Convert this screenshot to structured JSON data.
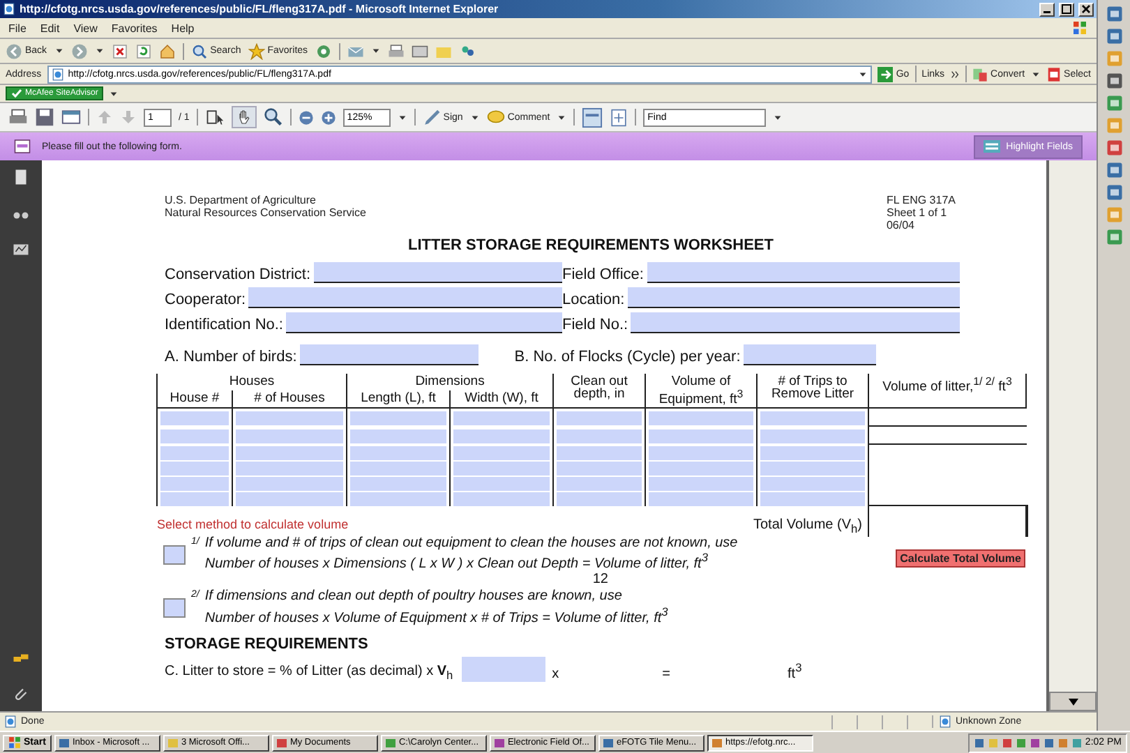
{
  "window": {
    "title": "http://cfotg.nrcs.usda.gov/references/public/FL/fleng317A.pdf - Microsoft Internet Explorer"
  },
  "menu": [
    "File",
    "Edit",
    "View",
    "Favorites",
    "Help"
  ],
  "toolbar": {
    "back": "Back",
    "search": "Search",
    "favorites": "Favorites"
  },
  "address": {
    "label": "Address",
    "url": "http://cfotg.nrcs.usda.gov/references/public/FL/fleng317A.pdf",
    "go": "Go",
    "links": "Links",
    "convert": "Convert",
    "select": "Select"
  },
  "mcafee": "McAfee SiteAdvisor",
  "pdf_toolbar": {
    "page": "1",
    "pages": "/ 1",
    "zoom": "125%",
    "sign": "Sign",
    "comment": "Comment",
    "find": "Find"
  },
  "form_bar": {
    "message": "Please fill out the following form.",
    "button": "Highlight Fields"
  },
  "document": {
    "agency": [
      "U.S. Department of Agriculture",
      "Natural Resources Conservation Service"
    ],
    "form_id": [
      "FL ENG 317A",
      "Sheet 1 of 1",
      "06/04"
    ],
    "title": "LITTER STORAGE REQUIREMENTS WORKSHEET",
    "field_rows": [
      [
        "Conservation District:",
        "Field Office:"
      ],
      [
        "Cooperator:",
        "Location:"
      ],
      [
        "Identification No.:",
        "Field No.:"
      ]
    ],
    "birds": "A.  Number of birds:",
    "flocks": "B.  No. of Flocks (Cycle) per year:",
    "table": {
      "column_groups": [
        {
          "label": "Houses",
          "columns": [
            "House #",
            "# of Houses"
          ]
        },
        {
          "label": "Dimensions",
          "columns": [
            "Length (L), ft",
            "Width (W), ft"
          ]
        },
        {
          "label": "Clean out depth, in"
        },
        {
          "label": "Volume of Equipment, ft$^{3}$"
        },
        {
          "label": "# of Trips to Remove Litter"
        },
        {
          "label": "Volume of litter,$^{1/ 2/}$ ft$^{3}$"
        }
      ],
      "rows": [
        {
          "kind": "full"
        },
        {
          "kind": "full"
        },
        {
          "kind": "short"
        },
        {
          "kind": "short"
        },
        {
          "kind": "short"
        },
        {
          "kind": "short"
        }
      ],
      "select_note": "Select method to calculate volume",
      "total": "Total Volume (V$_{h}$)"
    },
    "methods": [
      {
        "mark": "1/",
        "checked": false,
        "lines": [
          "If volume and # of trips of clean out equipment to clean the houses are not known, use",
          "Number of houses x Dimensions ( L x W ) x Clean out Depth  = Volume of litter, ft$^{3}$"
        ],
        "divisor": "12"
      },
      {
        "mark": "2/",
        "checked": false,
        "lines": [
          "If dimensions and clean out depth of poultry houses are known, use",
          "Number of houses x Volume of Equipment x # of Trips  = Volume of litter, ft$^{3}$"
        ]
      }
    ],
    "calculate_button": "Calculate Total Volume",
    "storage_heading": "STORAGE REQUIREMENTS",
    "storage_row": {
      "label": "C.   Litter to store = % of Litter (as decimal) x **V**$_{h}$",
      "times": "x",
      "equals": "=",
      "unit": "ft$^{3}$"
    }
  },
  "status_bar": {
    "left": "Done",
    "zone": "Unknown Zone"
  },
  "taskbar": {
    "start": "Start",
    "items": [
      {
        "label": "Inbox - Microsoft ...",
        "selected": false
      },
      {
        "label": "3 Microsoft Offi...",
        "selected": false
      },
      {
        "label": "My Documents",
        "selected": false
      },
      {
        "label": "C:\\Carolyn Center...",
        "selected": false
      },
      {
        "label": "Electronic Field Of...",
        "selected": false
      },
      {
        "label": "eFOTG Tile Menu...",
        "selected": false
      },
      {
        "label": "https://efotg.nrc...",
        "selected": true
      }
    ],
    "clock": "2:02 PM"
  }
}
